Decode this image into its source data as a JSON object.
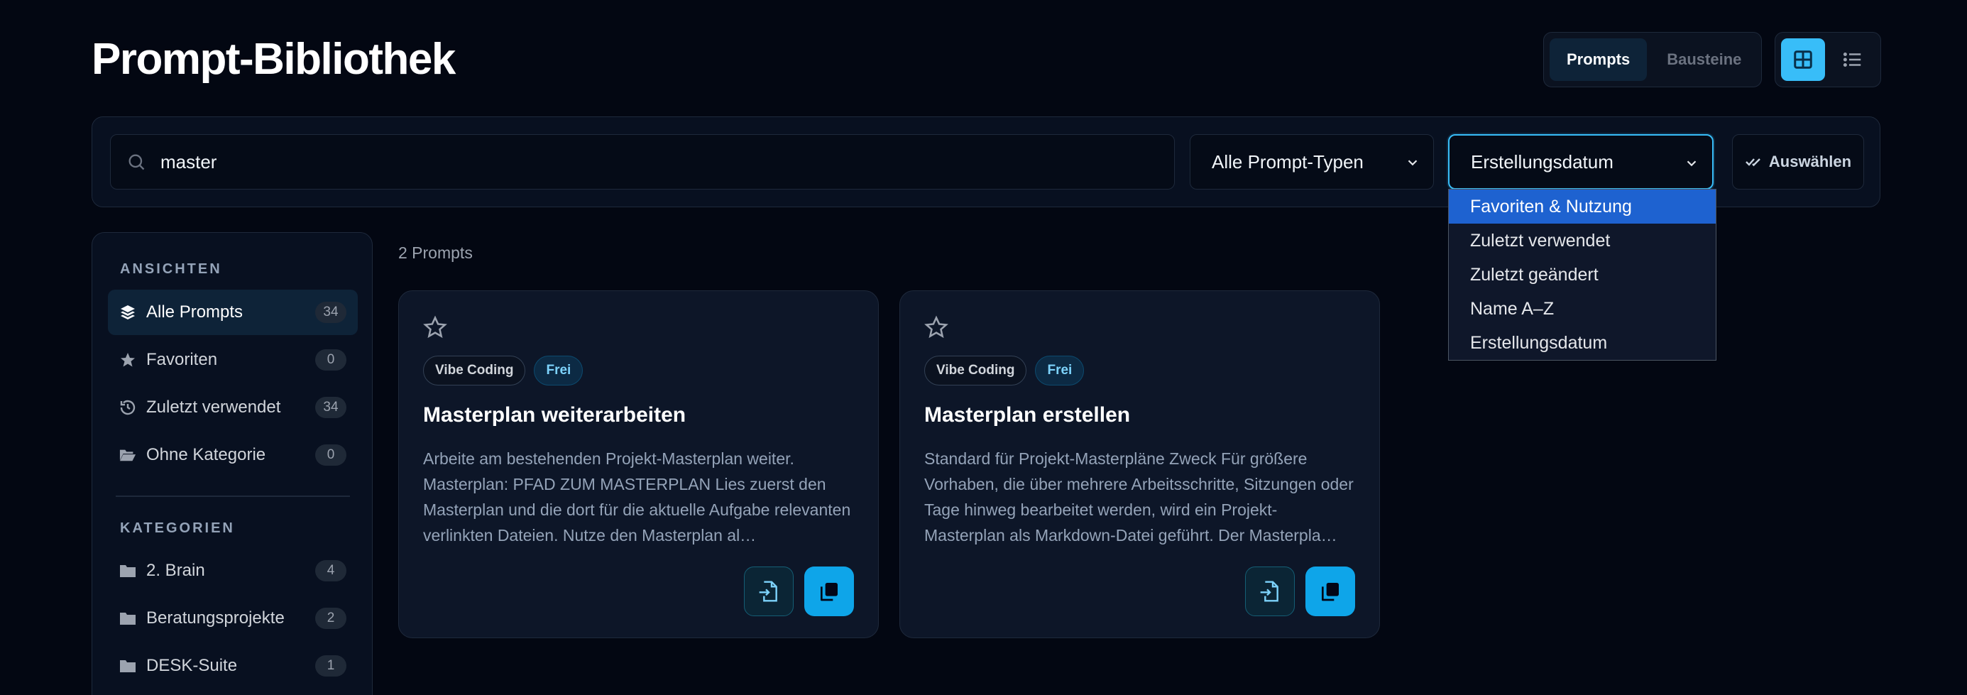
{
  "header": {
    "title": "Prompt-Bibliothek",
    "tabs": [
      {
        "label": "Prompts",
        "active": true
      },
      {
        "label": "Bausteine",
        "active": false
      }
    ],
    "view_modes": [
      {
        "icon": "grid-view-icon",
        "active": true
      },
      {
        "icon": "list-view-icon",
        "active": false
      }
    ]
  },
  "filters": {
    "search_value": "master",
    "type_select": "Alle Prompt-Typen",
    "sort_select": "Erstellungsdatum",
    "select_button": "Auswählen",
    "sort_options": [
      {
        "label": "Favoriten & Nutzung",
        "highlighted": true
      },
      {
        "label": "Zuletzt verwendet",
        "highlighted": false
      },
      {
        "label": "Zuletzt geändert",
        "highlighted": false
      },
      {
        "label": "Name A–Z",
        "highlighted": false
      },
      {
        "label": "Erstellungsdatum",
        "highlighted": false
      }
    ]
  },
  "sidebar": {
    "views_label": "ANSICHTEN",
    "views": [
      {
        "label": "Alle Prompts",
        "count": "34",
        "icon": "layers-icon",
        "active": true
      },
      {
        "label": "Favoriten",
        "count": "0",
        "icon": "star-icon",
        "active": false
      },
      {
        "label": "Zuletzt verwendet",
        "count": "34",
        "icon": "history-icon",
        "active": false
      },
      {
        "label": "Ohne Kategorie",
        "count": "0",
        "icon": "folder-open-icon",
        "active": false
      }
    ],
    "categories_label": "KATEGORIEN",
    "categories": [
      {
        "label": "2. Brain",
        "count": "4",
        "icon": "folder-icon"
      },
      {
        "label": "Beratungsprojekte",
        "count": "2",
        "icon": "folder-icon"
      },
      {
        "label": "DESK-Suite",
        "count": "1",
        "icon": "folder-icon"
      }
    ]
  },
  "main": {
    "result_count": "2 Prompts",
    "cards": [
      {
        "category": "Vibe Coding",
        "badge": "Frei",
        "title": "Masterplan weiterarbeiten",
        "description": "Arbeite am bestehenden Projekt-Masterplan weiter. Masterplan: PFAD ZUM MASTERPLAN Lies zuerst den Masterplan und die dort für die aktuelle Aufgabe relevanten verlinkten Dateien. Nutze den Masterplan al…"
      },
      {
        "category": "Vibe Coding",
        "badge": "Frei",
        "title": "Masterplan erstellen",
        "description": "Standard für Projekt-Masterpläne Zweck Für größere Vorhaben, die über mehrere Arbeitsschritte, Sitzungen oder Tage hinweg bearbeitet werden, wird ein Projekt-Masterplan als Markdown-Datei geführt. Der Masterpla…"
      }
    ]
  },
  "colors": {
    "background": "#030712",
    "accent": "#0ea5e9",
    "dropdown_highlight": "#1e62d0"
  }
}
